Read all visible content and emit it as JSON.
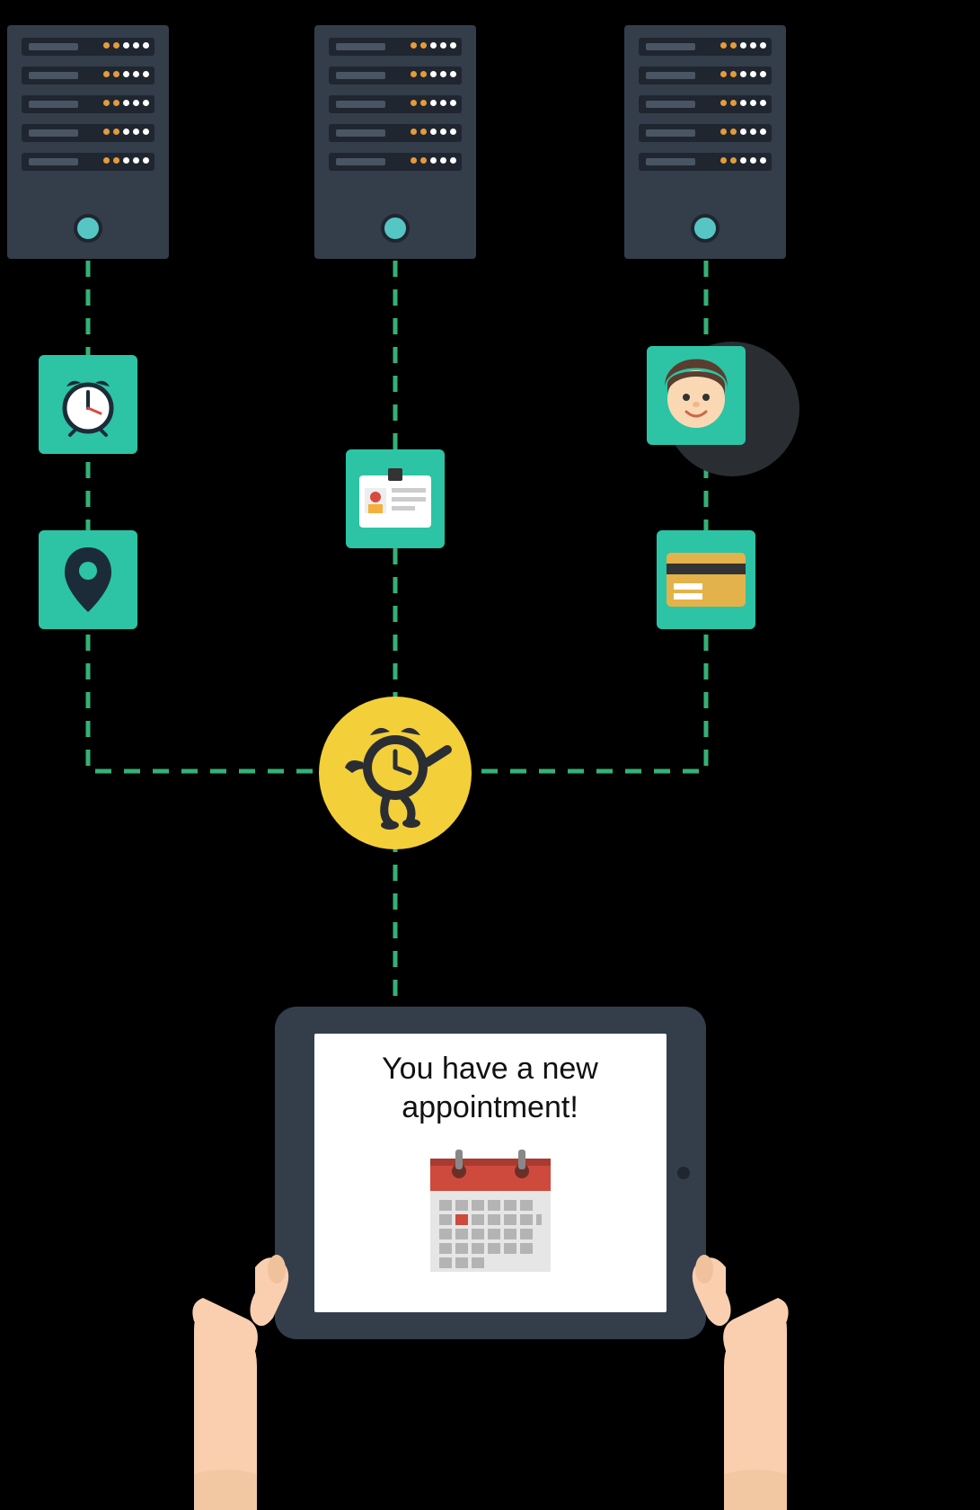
{
  "colors": {
    "bg": "#000000",
    "server_body": "#343d4a",
    "server_dark": "#1f2630",
    "server_led_white": "#ffffff",
    "server_led_orange": "#e59b3a",
    "server_button": "#56c6c5",
    "tile": "#2cc4a4",
    "hub": "#f3cf3a",
    "dash": "#34b176",
    "skin": "#f9cfb0",
    "card_gold": "#e3b24a"
  },
  "servers": {
    "count": 3,
    "slots_per_server": 5,
    "led_pattern": [
      "orange",
      "orange",
      "white",
      "white",
      "white"
    ]
  },
  "tiles": {
    "left_top": {
      "icon": "alarm-clock-icon"
    },
    "left_bot": {
      "icon": "location-pin-icon"
    },
    "center": {
      "icon": "id-card-icon"
    },
    "right_top": {
      "icon": "avatar-icon"
    },
    "right_bot": {
      "icon": "credit-card-icon"
    }
  },
  "hub": {
    "icon": "running-clock-icon"
  },
  "tablet": {
    "message_line1": "You have a new",
    "message_line2": "appointment!",
    "screen_icon": "calendar-icon"
  }
}
